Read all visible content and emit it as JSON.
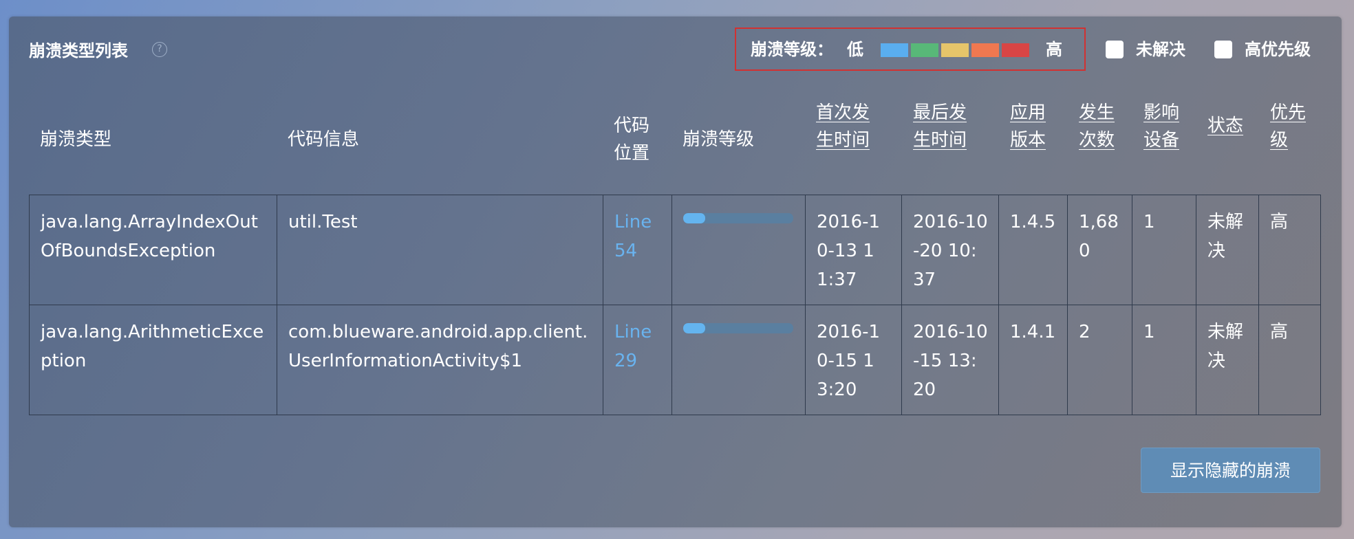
{
  "panel": {
    "title": "崩溃类型列表",
    "help_glyph": "?"
  },
  "legend": {
    "label": "崩溃等级：",
    "low": "低",
    "high": "高",
    "colors": [
      "#5aaeef",
      "#58b878",
      "#e6c56a",
      "#f07850",
      "#d94545"
    ]
  },
  "filters": [
    {
      "label": "未解决",
      "checked": false
    },
    {
      "label": "高优先级",
      "checked": false
    }
  ],
  "columns": [
    {
      "label": "崩溃类型",
      "sortable": false
    },
    {
      "label": "代码信息",
      "sortable": false
    },
    {
      "label": "代码位置",
      "sortable": false
    },
    {
      "label": "崩溃等级",
      "sortable": false
    },
    {
      "label": "首次发生时间",
      "sortable": true
    },
    {
      "label": "最后发生时间",
      "sortable": true
    },
    {
      "label": "应用版本",
      "sortable": true
    },
    {
      "label": "发生次数",
      "sortable": true
    },
    {
      "label": "影响设备",
      "sortable": true
    },
    {
      "label": "状态",
      "sortable": true
    },
    {
      "label": "优先级",
      "sortable": true
    }
  ],
  "rows": [
    {
      "crash_type": "java.lang.ArrayIndexOutOfBoundsException",
      "code_info": "util.Test",
      "code_location": "Line 54",
      "crash_level": 0.2,
      "first_time": "2016-10-13 11:37",
      "last_time": "2016-10-20 10:37",
      "app_version": "1.4.5",
      "count": "1,680",
      "devices": "1",
      "status": "未解决",
      "priority": "高"
    },
    {
      "crash_type": "java.lang.ArithmeticException",
      "code_info": "com.blueware.android.app.client.UserInformationActivity$1",
      "code_location": "Line 29",
      "crash_level": 0.2,
      "first_time": "2016-10-15 13:20",
      "last_time": "2016-10-15 13:20",
      "app_version": "1.4.1",
      "count": "2",
      "devices": "1",
      "status": "未解决",
      "priority": "高"
    }
  ],
  "show_hidden_button": "显示隐藏的崩溃"
}
